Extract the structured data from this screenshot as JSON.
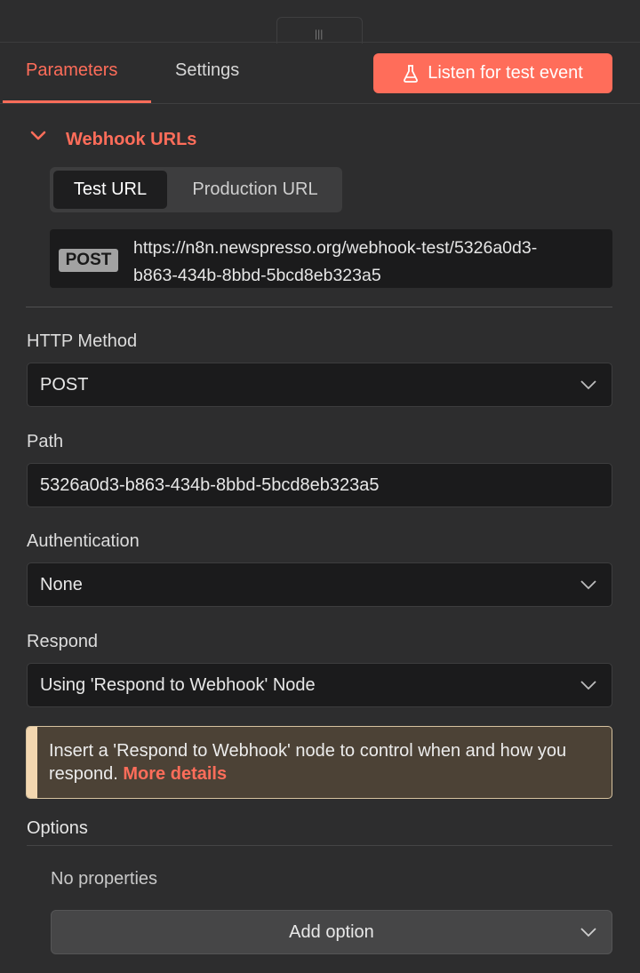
{
  "tabs": {
    "parameters": "Parameters",
    "settings": "Settings"
  },
  "listen_button": {
    "label": "Listen for test event",
    "icon": "flask-icon"
  },
  "webhook_urls": {
    "title": "Webhook URLs",
    "switch": {
      "test": "Test URL",
      "production": "Production URL",
      "selected": "Test URL"
    },
    "method": "POST",
    "url_line1": "https://n8n.newspresso.org/webhook-test/5326a0d3-",
    "url_line2": "b863-434b-8bbd-5bcd8eb323a5"
  },
  "fields": {
    "http_method": {
      "label": "HTTP Method",
      "value": "POST"
    },
    "path": {
      "label": "Path",
      "value": "5326a0d3-b863-434b-8bbd-5bcd8eb323a5"
    },
    "authentication": {
      "label": "Authentication",
      "value": "None"
    },
    "respond": {
      "label": "Respond",
      "value": "Using 'Respond to Webhook' Node"
    }
  },
  "notice": {
    "text": "Insert a 'Respond to Webhook' node to control when and how you respond. ",
    "link": "More details"
  },
  "options": {
    "title": "Options",
    "empty": "No properties",
    "add_label": "Add option"
  },
  "colors": {
    "accent": "#ff6d5a",
    "background": "#2d2d2e",
    "input_bg": "#1b1b1c",
    "notice_bg": "#4c4236"
  }
}
